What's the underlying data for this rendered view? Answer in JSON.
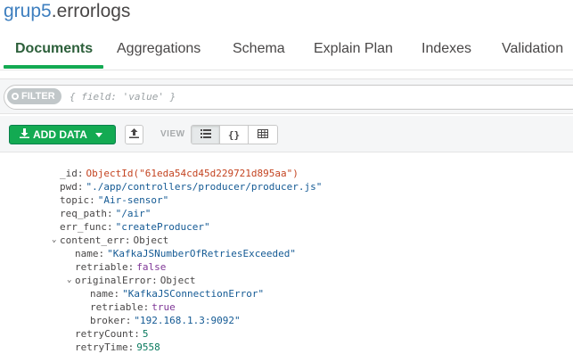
{
  "namespace": {
    "db": "grup5",
    "separator": ".",
    "collection": "errorlogs"
  },
  "tabs": [
    {
      "label": "Documents",
      "active": true
    },
    {
      "label": "Aggregations"
    },
    {
      "label": "Schema"
    },
    {
      "label": "Explain Plan"
    },
    {
      "label": "Indexes"
    },
    {
      "label": "Validation"
    }
  ],
  "filter": {
    "label": "FILTER",
    "placeholder": "{ field: 'value' }"
  },
  "toolbar": {
    "add_data_label": "ADD DATA",
    "view_label": "VIEW"
  },
  "icons": {
    "download": "download-icon",
    "export": "export-icon",
    "list": "list-view-icon",
    "json": "json-view-icon",
    "table": "table-view-icon"
  },
  "colors": {
    "accent": "#13aa52",
    "link": "#3e7fbf",
    "string": "#145a94",
    "objectid": "#c44421",
    "boolean": "#7e3696",
    "number": "#0a7a5e"
  },
  "document": {
    "_id": {
      "key": "_id",
      "value": "ObjectId(\"61eda54cd45d229721d895aa\")"
    },
    "pwd": {
      "key": "pwd",
      "value": "\"./app/controllers/producer/producer.js\""
    },
    "topic": {
      "key": "topic",
      "value": "\"Air-sensor\""
    },
    "req_path": {
      "key": "req_path",
      "value": "\"/air\""
    },
    "err_func": {
      "key": "err_func",
      "value": "\"createProducer\""
    },
    "content_err": {
      "key": "content_err",
      "type": "Object",
      "name": {
        "key": "name",
        "value": "\"KafkaJSNumberOfRetriesExceeded\""
      },
      "retriable": {
        "key": "retriable",
        "value": "false"
      },
      "originalError": {
        "key": "originalError",
        "type": "Object",
        "name": {
          "key": "name",
          "value": "\"KafkaJSConnectionError\""
        },
        "retriable": {
          "key": "retriable",
          "value": "true"
        },
        "broker": {
          "key": "broker",
          "value": "\"192.168.1.3:9092\""
        }
      },
      "retryCount": {
        "key": "retryCount",
        "value": "5"
      },
      "retryTime": {
        "key": "retryTime",
        "value": "9558"
      }
    }
  }
}
